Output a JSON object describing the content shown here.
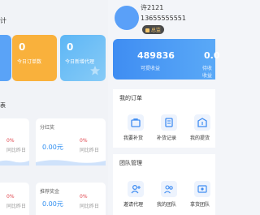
{
  "left": {
    "title_partial": "计",
    "cards": [
      {
        "num": "0",
        "label": "今日订单",
        "partial_label": "今"
      },
      {
        "num": "0",
        "label": "今日订单数"
      },
      {
        "num": "0",
        "label": "今日新增代理"
      }
    ],
    "subtitle_partial": "表",
    "stats": [
      {
        "pct": "0%",
        "cmp": "同比昨日"
      },
      {
        "title": "分红奖",
        "amt": "0.00元",
        "pct": "0%",
        "cmp": "同比昨日"
      },
      {
        "pct": "0%",
        "cmp": "同比昨日"
      },
      {
        "title": "推荐奖金",
        "amt": "0.00元",
        "pct": "0%",
        "cmp": "同比昨日"
      }
    ]
  },
  "user": {
    "name": "许2121",
    "phone": "13655555551",
    "badge": "总监"
  },
  "banner": {
    "earn_value": "489836",
    "earn_label": "可提收益",
    "second_value": "0.0",
    "second_label": "待收收益"
  },
  "orders": {
    "title": "我的订单",
    "items": [
      "我要补货",
      "补货记录",
      "我的提货"
    ]
  },
  "team": {
    "title": "团队管理",
    "items": [
      "邀请代理",
      "我的团队",
      "拿货团队"
    ]
  },
  "colors": {
    "accent": "#3f8df2",
    "orange": "#f9b13c",
    "red": "#e0444c"
  }
}
